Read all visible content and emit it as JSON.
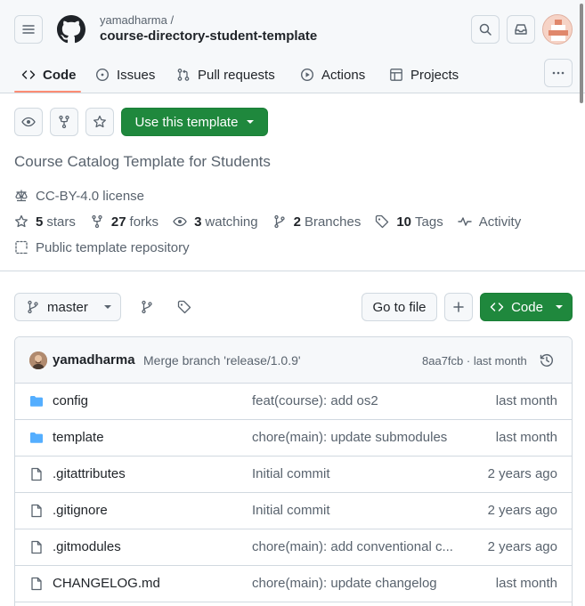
{
  "header": {
    "owner": "yamadharma /",
    "repo": "course-directory-student-template"
  },
  "nav": {
    "tabs": [
      {
        "label": "Code",
        "icon": "code-icon",
        "active": true
      },
      {
        "label": "Issues",
        "icon": "issue-opened-icon"
      },
      {
        "label": "Pull requests",
        "icon": "git-pull-request-icon"
      },
      {
        "label": "Actions",
        "icon": "play-icon"
      },
      {
        "label": "Projects",
        "icon": "table-icon"
      }
    ]
  },
  "repo": {
    "use_template_label": "Use this template",
    "description": "Course Catalog Template for Students",
    "license": "CC-BY-4.0 license",
    "stars_count": "5",
    "stars_label": "stars",
    "forks_count": "27",
    "forks_label": "forks",
    "watching_count": "3",
    "watching_label": "watching",
    "branches_count": "2",
    "branches_label": "Branches",
    "tags_count": "10",
    "tags_label": "Tags",
    "activity_label": "Activity",
    "visibility": "Public template repository"
  },
  "branch_bar": {
    "branch": "master",
    "goto_file": "Go to file",
    "code_label": "Code"
  },
  "latest_commit": {
    "author": "yamadharma",
    "message": "Merge branch 'release/1.0.9'",
    "sha_time": "8aa7fcb · last month"
  },
  "files": [
    {
      "name": "config",
      "type": "dir",
      "commit": "feat(course): add os2",
      "age": "last month"
    },
    {
      "name": "template",
      "type": "dir",
      "commit": "chore(main): update submodules",
      "age": "last month"
    },
    {
      "name": ".gitattributes",
      "type": "file",
      "commit": "Initial commit",
      "age": "2 years ago"
    },
    {
      "name": ".gitignore",
      "type": "file",
      "commit": "Initial commit",
      "age": "2 years ago"
    },
    {
      "name": ".gitmodules",
      "type": "file",
      "commit": "chore(main): add conventional c...",
      "age": "2 years ago"
    },
    {
      "name": "CHANGELOG.md",
      "type": "file",
      "commit": "chore(main): update changelog",
      "age": "last month"
    }
  ],
  "colors": {
    "primary_button": "#1f883d",
    "active_tab_underline": "#fd8c73",
    "folder_icon": "#54aeff",
    "muted_text": "#59636e"
  }
}
